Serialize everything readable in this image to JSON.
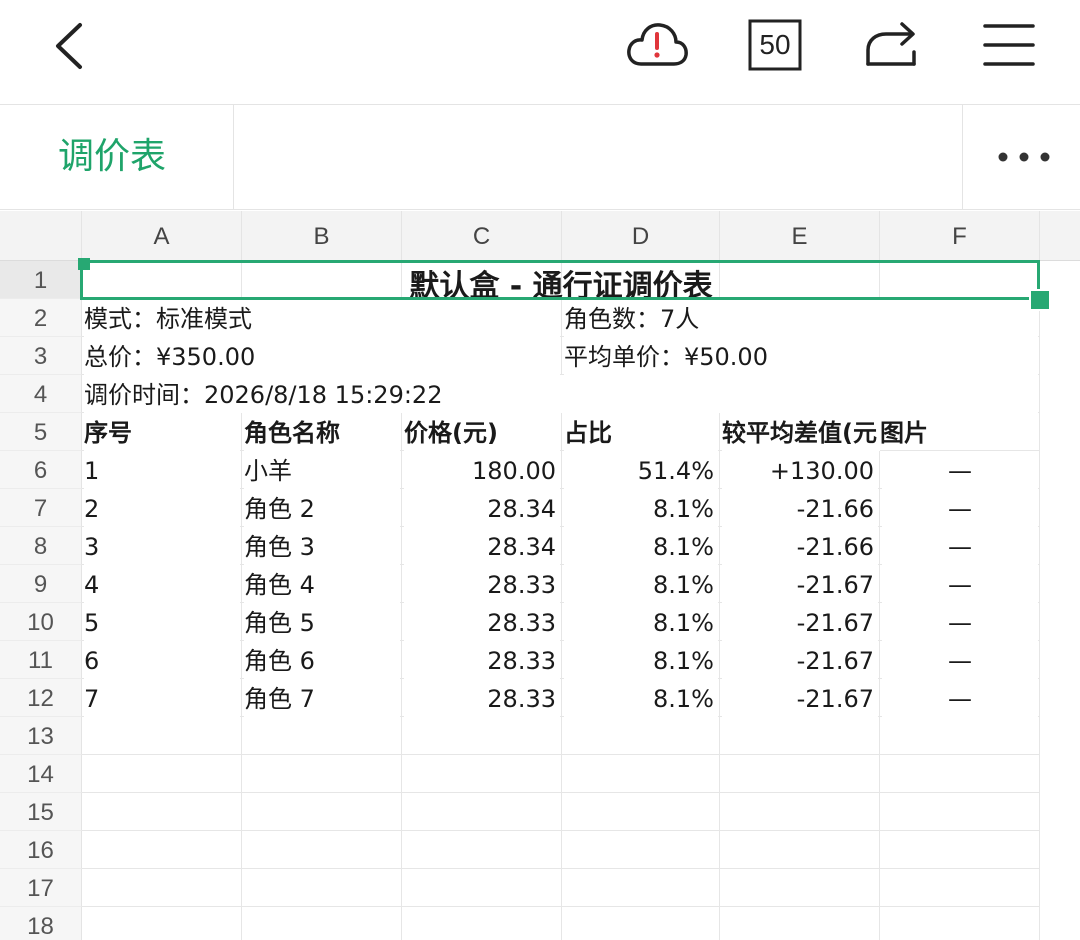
{
  "toolbar": {
    "count": "50"
  },
  "sheet_tab": {
    "label": "调价表"
  },
  "columns": [
    "A",
    "B",
    "C",
    "D",
    "E",
    "F"
  ],
  "rows": [
    "1",
    "2",
    "3",
    "4",
    "5",
    "6",
    "7",
    "8",
    "9",
    "10",
    "11",
    "12",
    "13",
    "14",
    "15",
    "16",
    "17",
    "18"
  ],
  "sheet": {
    "title": "默认盒 - 通行证调价表",
    "mode": "模式：标准模式",
    "role_count": "角色数：7人",
    "total": "总价：¥350.00",
    "avg_price": "平均单价：¥50.00",
    "time": "调价时间：2026/8/18 15:29:22",
    "headers": [
      "序号",
      "角色名称",
      "价格(元)",
      "占比",
      "较平均差值(元",
      "图片"
    ],
    "data": [
      [
        "1",
        "小羊",
        "180.00",
        "51.4%",
        "+130.00",
        "—"
      ],
      [
        "2",
        "角色 2",
        "28.34",
        "8.1%",
        "-21.66",
        "—"
      ],
      [
        "3",
        "角色 3",
        "28.34",
        "8.1%",
        "-21.66",
        "—"
      ],
      [
        "4",
        "角色 4",
        "28.33",
        "8.1%",
        "-21.67",
        "—"
      ],
      [
        "5",
        "角色 5",
        "28.33",
        "8.1%",
        "-21.67",
        "—"
      ],
      [
        "6",
        "角色 6",
        "28.33",
        "8.1%",
        "-21.67",
        "—"
      ],
      [
        "7",
        "角色 7",
        "28.33",
        "8.1%",
        "-21.67",
        "—"
      ]
    ]
  },
  "colors": {
    "accent": "#1fa46a",
    "selection": "#27a873",
    "warning": "#e0353b"
  },
  "icons": [
    "back-icon",
    "cloud-warning-icon",
    "count-icon",
    "share-icon",
    "menu-icon",
    "more-icon"
  ]
}
